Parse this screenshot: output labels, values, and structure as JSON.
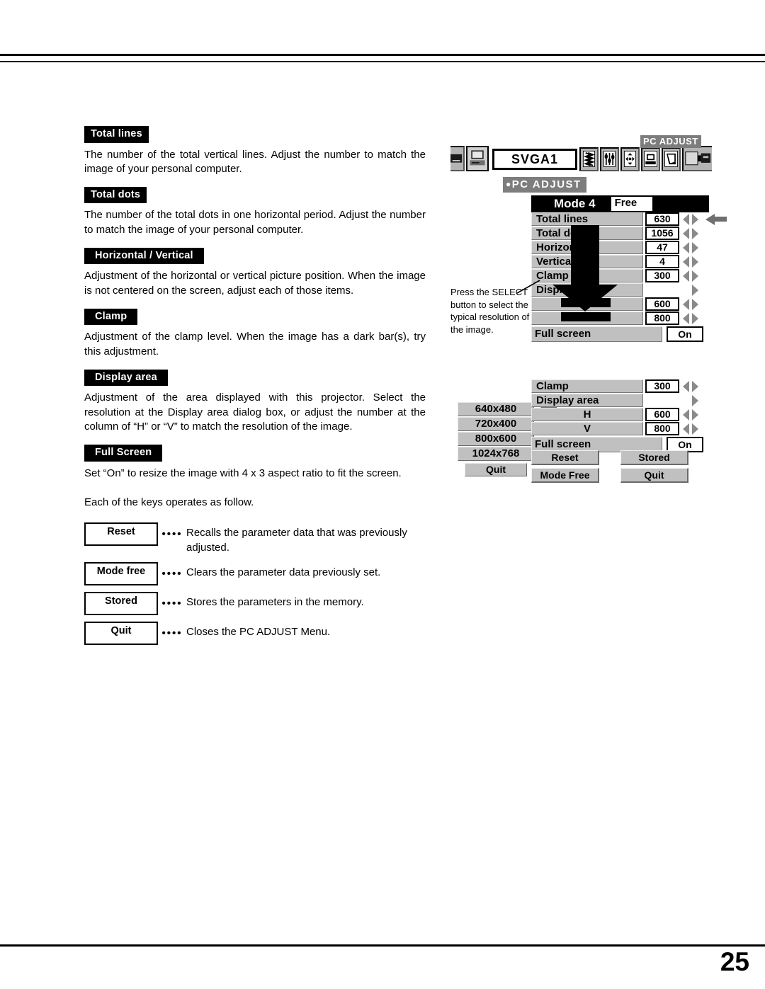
{
  "page": {
    "number": "25"
  },
  "sections": [
    {
      "heading": "Total lines",
      "body": "The number of the total vertical lines.  Adjust the number to match the image of your personal computer."
    },
    {
      "heading": "Total dots",
      "body": "The number of the total dots in one horizontal period.  Adjust the number to match the image of your personal computer."
    },
    {
      "heading": "Horizontal / Vertical",
      "body": "Adjustment of the horizontal or vertical picture position.  When the image is not centered on the screen, adjust each of those items."
    },
    {
      "heading": "Clamp",
      "body": "Adjustment of the clamp level.  When the image has a dark bar(s), try this adjustment."
    },
    {
      "heading": "Display area",
      "body": "Adjustment of the area displayed with this projector.  Select the resolution at the Display area dialog box, or adjust the number at the column of “H” or  “V” to match the resolution of the image."
    },
    {
      "heading": "Full Screen",
      "body": "Set “On” to resize the image with 4 x 3 aspect ratio to fit the screen."
    }
  ],
  "keys_intro": "Each of the keys operates as follow.",
  "keys": [
    {
      "label": "Reset",
      "dots": "••••",
      "description": "Recalls the parameter data that was previously adjusted."
    },
    {
      "label": "Mode free",
      "dots": "••••",
      "description": "Clears the parameter data previously set."
    },
    {
      "label": "Stored",
      "dots": "••••",
      "description": "Stores the parameters in the memory."
    },
    {
      "label": "Quit",
      "dots": "••••",
      "description": "Closes the PC ADJUST Menu."
    }
  ],
  "osd": {
    "menubar": {
      "input_label": "SVGA1",
      "tooltip": "PC ADJUST",
      "icons": [
        "video-source-icon",
        "computer-source-icon",
        "fine-sync-icon",
        "tuning-sliders-icon",
        "position-arrows-icon",
        "pc-adjust-icon",
        "screen-icon",
        "projector-icon"
      ]
    },
    "menu_title": "PC ADJUST",
    "menu_title_bullet": "●",
    "dialog1": {
      "mode_label": "Mode 4",
      "mode_state": "Free",
      "rows": [
        {
          "label": "Total lines",
          "value": "630",
          "spinner": "left-right"
        },
        {
          "label": "Total dots",
          "value": "1056",
          "spinner": "left-right"
        },
        {
          "label": "Horizontal",
          "value": "47",
          "spinner": "left-right"
        },
        {
          "label": "Vertical",
          "value": "4",
          "spinner": "left-right"
        },
        {
          "label": "Clamp",
          "value": "300",
          "spinner": "left-right"
        },
        {
          "label": "Display area",
          "value": "",
          "spinner": "right"
        },
        {
          "label": "H",
          "value": "600",
          "spinner": "left-right"
        },
        {
          "label": "V",
          "value": "800",
          "spinner": "left-right"
        }
      ],
      "full_screen_label": "Full screen",
      "full_screen_value": "On"
    },
    "callout": "Press the SELECT button to select the typical resolution of the image.",
    "dialog2": {
      "rows": [
        {
          "label": "Clamp",
          "value": "300",
          "spinner": "left-right"
        },
        {
          "label": "Display area",
          "value": "",
          "spinner": "right"
        },
        {
          "label": "H",
          "value": "600",
          "spinner": "left-right"
        },
        {
          "label": "V",
          "value": "800",
          "spinner": "left-right"
        }
      ],
      "full_screen_label": "Full screen",
      "full_screen_value": "On",
      "buttons": [
        {
          "label": "Reset"
        },
        {
          "label": "Stored"
        },
        {
          "label": "Mode Free"
        },
        {
          "label": "Quit"
        }
      ]
    },
    "resolution_list": {
      "items": [
        "640x480",
        "720x400",
        "800x600",
        "1024x768"
      ],
      "quit_label": "Quit"
    }
  },
  "colors": {
    "osd_face": "#c0c0c0",
    "osd_titlebar": "#000000",
    "tooltip_gray": "#7d7d7d",
    "arrow_gray": "#6f6f6f"
  }
}
